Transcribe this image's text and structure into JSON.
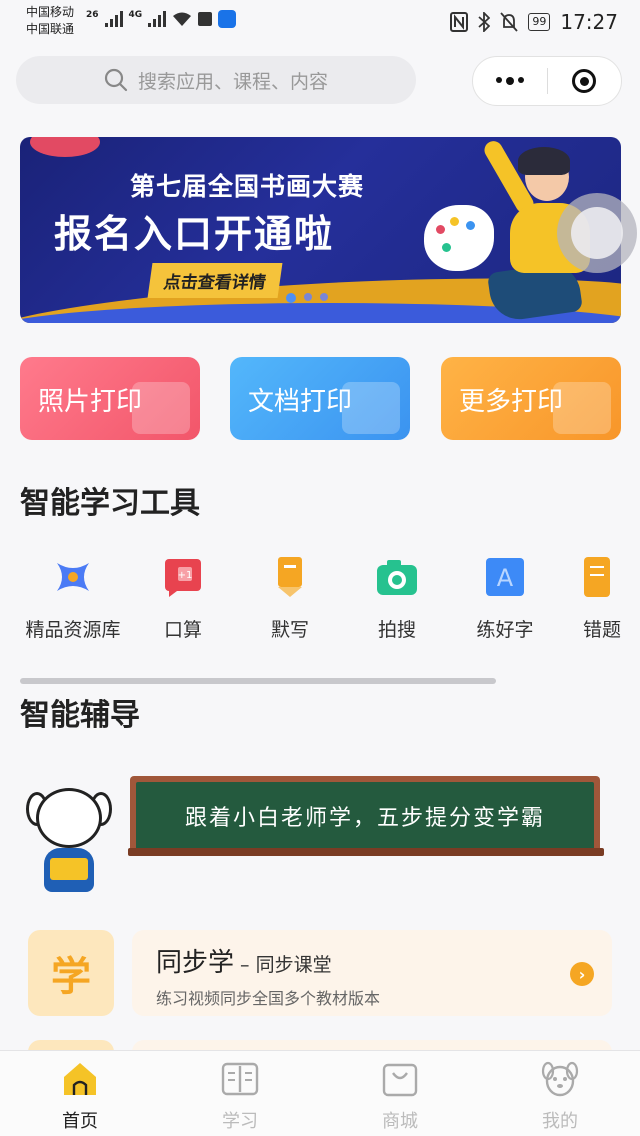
{
  "status_bar": {
    "carrier1": "中国移动",
    "carrier2": "中国联通",
    "net1": "26",
    "net2": "4G",
    "battery": "99",
    "time": "17:27"
  },
  "search": {
    "placeholder": "搜索应用、课程、内容"
  },
  "banner": {
    "title_line1": "第七届全国书画大赛",
    "title_line2": "报名入口开通啦",
    "cta": "点击查看详情",
    "page_count": 3,
    "active_page": 1
  },
  "print_buttons": [
    {
      "label": "照片打印",
      "color": "#f2566a"
    },
    {
      "label": "文档打印",
      "color": "#3b93f0"
    },
    {
      "label": "更多打印",
      "color": "#f8962a"
    }
  ],
  "sections": {
    "tools_title": "智能学习工具",
    "tutor_title": "智能辅导"
  },
  "tools": [
    {
      "label": "精品资源库",
      "icon": "resource-library-icon",
      "color": "#4b7bf5"
    },
    {
      "label": "口算",
      "icon": "mental-math-icon",
      "color": "#e8434f"
    },
    {
      "label": "默写",
      "icon": "dictation-icon",
      "color": "#f5a623"
    },
    {
      "label": "拍搜",
      "icon": "camera-search-icon",
      "color": "#26c28f"
    },
    {
      "label": "练好字",
      "icon": "handwriting-icon",
      "color": "#3d8af7"
    },
    {
      "label": "错题",
      "icon": "wrong-questions-icon",
      "color": "#f5a623"
    }
  ],
  "tutor": {
    "board_text": "跟着小白老师学，五步提分变学霸"
  },
  "course": {
    "badge": "学",
    "name": "同步学",
    "sub": " – 同步课堂",
    "desc": "练习视频同步全国多个教材版本"
  },
  "tabbar": [
    {
      "label": "首页",
      "icon": "home-icon",
      "active": true
    },
    {
      "label": "学习",
      "icon": "book-icon",
      "active": false
    },
    {
      "label": "商城",
      "icon": "shopping-bag-icon",
      "active": false
    },
    {
      "label": "我的",
      "icon": "profile-icon",
      "active": false
    }
  ]
}
